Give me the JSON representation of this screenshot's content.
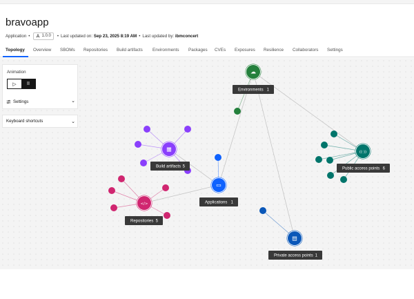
{
  "app": {
    "title": "bravoapp",
    "type_label": "Application",
    "version": "1.0.0",
    "updated_on_label": "Last updated on:",
    "updated_on": "Sep 23, 2025 8:19 AM",
    "updated_by_label": "Last updated by:",
    "updated_by": "ibmconcert"
  },
  "tabs": [
    "Topology",
    "Overview",
    "SBOMs",
    "Repositories",
    "Build artifacts",
    "Environments",
    "Packages",
    "CVEs",
    "Exposures",
    "Resilience",
    "Collaborators",
    "Settings"
  ],
  "active_tab": "Topology",
  "animation": {
    "label": "Animation",
    "play_glyph": "▷",
    "pause_glyph": "II"
  },
  "settings": {
    "label": "Settings"
  },
  "shortcuts": {
    "label": "Keyboard shortcuts"
  },
  "colors": {
    "environments": "#24803c",
    "public": "#00756b",
    "applications": "#0f62fe",
    "build": "#8a3ffc",
    "repositories": "#d02670",
    "private": "#0a57b8",
    "label_bg": "#393939",
    "edge": "#c6c6c6"
  },
  "graph": {
    "nodes": [
      {
        "id": "environments",
        "label": "Environments",
        "count": "1",
        "icon": "cloud-icon",
        "glyph": "☁"
      },
      {
        "id": "public",
        "label": "Public access points",
        "count": "6",
        "icon": "broadcast-icon",
        "glyph": "((·))"
      },
      {
        "id": "applications",
        "label": "Applications",
        "count": "1",
        "icon": "monitor-icon",
        "glyph": "▭"
      },
      {
        "id": "build",
        "label": "Build artifacts",
        "count": "5",
        "icon": "build-icon",
        "glyph": "▦"
      },
      {
        "id": "repositories",
        "label": "Repositories",
        "count": "5",
        "icon": "code-icon",
        "glyph": "</>"
      },
      {
        "id": "private",
        "label": "Private access points",
        "count": "1",
        "icon": "server-icon",
        "glyph": "▤"
      }
    ]
  }
}
